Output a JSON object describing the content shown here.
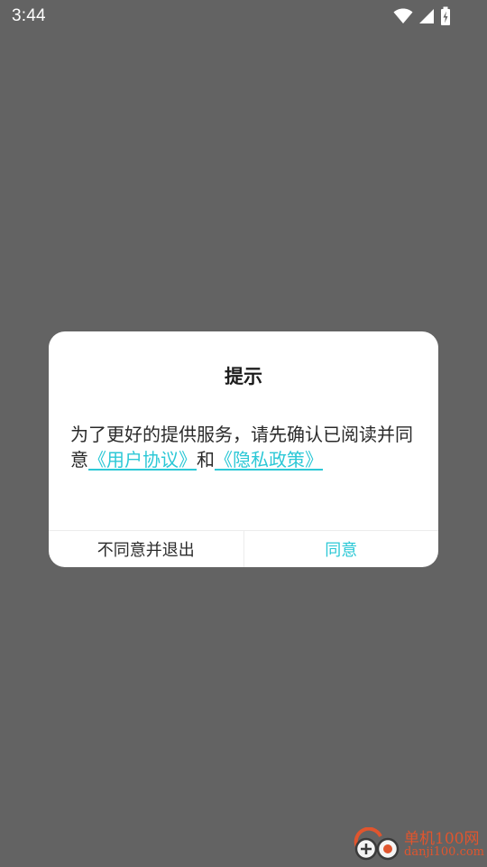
{
  "status_bar": {
    "time": "3:44",
    "icons": [
      "wifi-icon",
      "cell-signal-icon",
      "battery-charging-icon"
    ]
  },
  "dialog": {
    "title": "提示",
    "message_before": "为了更好的提供服务，请先确认已阅读并同意",
    "link_user_agreement": "《用户协议》",
    "message_and": "和",
    "link_privacy_policy": "《隐私政策》",
    "disagree_label": "不同意并退出",
    "agree_label": "同意"
  },
  "watermark": {
    "name": "单机100网",
    "url": "danji100.com"
  },
  "colors": {
    "background": "#636363",
    "accent": "#2cc8d6",
    "dialog_bg": "#ffffff",
    "watermark": "#e0552e"
  }
}
